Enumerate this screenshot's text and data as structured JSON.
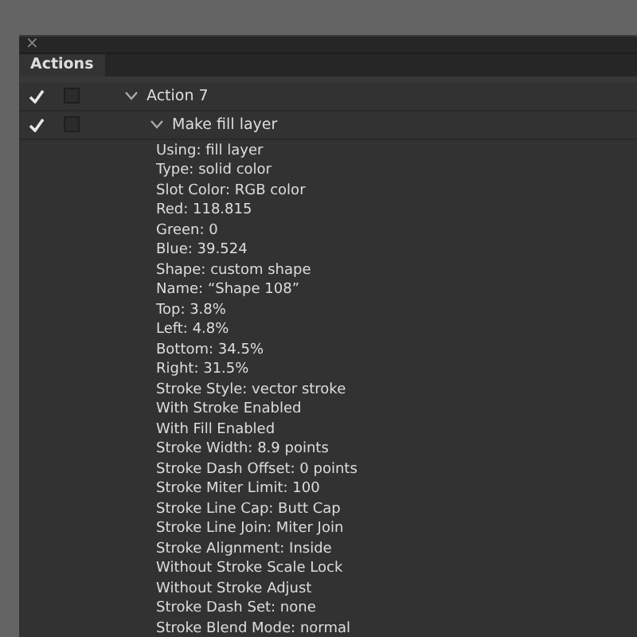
{
  "panel": {
    "close": "×",
    "tabs": [
      {
        "label": "Actions",
        "selected": true
      }
    ]
  },
  "actions": [
    {
      "name": "Action 7",
      "checked": true,
      "expanded": true,
      "children": [
        {
          "name": "Make fill layer",
          "checked": true,
          "expanded": true,
          "details": [
            "Using: fill layer",
            "Type: solid color",
            "Slot Color: RGB color",
            "Red: 118.815",
            "Green: 0",
            "Blue: 39.524",
            "Shape: custom shape",
            "Name:  “Shape 108”",
            "Top: 3.8%",
            "Left: 4.8%",
            "Bottom: 34.5%",
            "Right: 31.5%",
            "Stroke Style: vector stroke",
            "With Stroke Enabled",
            "With Fill Enabled",
            "Stroke Width: 8.9 points",
            "Stroke Dash Offset: 0 points",
            "Stroke Miter Limit: 100",
            "Stroke Line Cap: Butt Cap",
            "Stroke Line Join: Miter Join",
            "Stroke Alignment: Inside",
            "Without Stroke Scale Lock",
            "Without Stroke Adjust",
            "Stroke Dash Set: none",
            "Stroke Blend Mode: normal"
          ]
        }
      ]
    }
  ]
}
